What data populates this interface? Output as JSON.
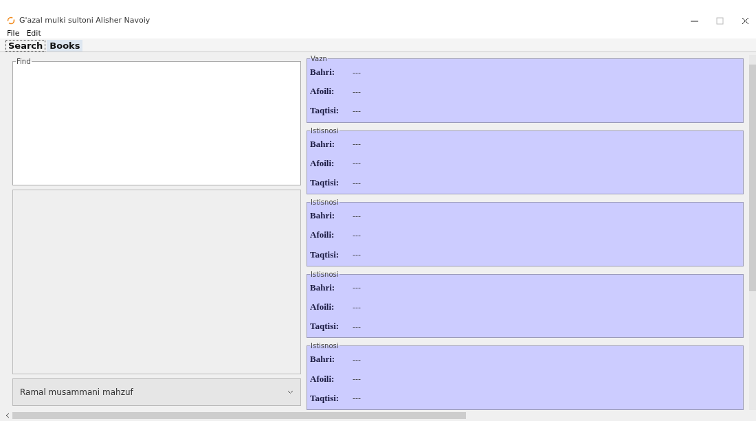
{
  "window": {
    "title": "G'azal mulki sultoni Alisher Navoiy"
  },
  "menu": [
    "File",
    "Edit"
  ],
  "tabs": [
    {
      "label": "Search",
      "selected": true
    },
    {
      "label": "Books",
      "selected": false
    }
  ],
  "find": {
    "title": "Find"
  },
  "meter_select": {
    "value": "Ramal musammani mahzuf"
  },
  "groups": [
    {
      "title": "Vazn",
      "rows": [
        {
          "label": "Bahri:",
          "value": "---"
        },
        {
          "label": "Afoili:",
          "value": "---"
        },
        {
          "label": "Taqtisi:",
          "value": "---"
        }
      ]
    },
    {
      "title": "Istisnosi",
      "rows": [
        {
          "label": "Bahri:",
          "value": "---"
        },
        {
          "label": "Afoili:",
          "value": "---"
        },
        {
          "label": "Taqtisi:",
          "value": "---"
        }
      ]
    },
    {
      "title": "Istisnosi",
      "rows": [
        {
          "label": "Bahri:",
          "value": "---"
        },
        {
          "label": "Afoili:",
          "value": "---"
        },
        {
          "label": "Taqtisi:",
          "value": "---"
        }
      ]
    },
    {
      "title": "Istisnosi",
      "rows": [
        {
          "label": "Bahri:",
          "value": "---"
        },
        {
          "label": "Afoili:",
          "value": "---"
        },
        {
          "label": "Taqtisi:",
          "value": "---"
        }
      ]
    },
    {
      "title": "Istisnosi",
      "rows": [
        {
          "label": "Bahri:",
          "value": "---"
        },
        {
          "label": "Afoili:",
          "value": "---"
        },
        {
          "label": "Taqtisi:",
          "value": "---"
        }
      ]
    }
  ]
}
